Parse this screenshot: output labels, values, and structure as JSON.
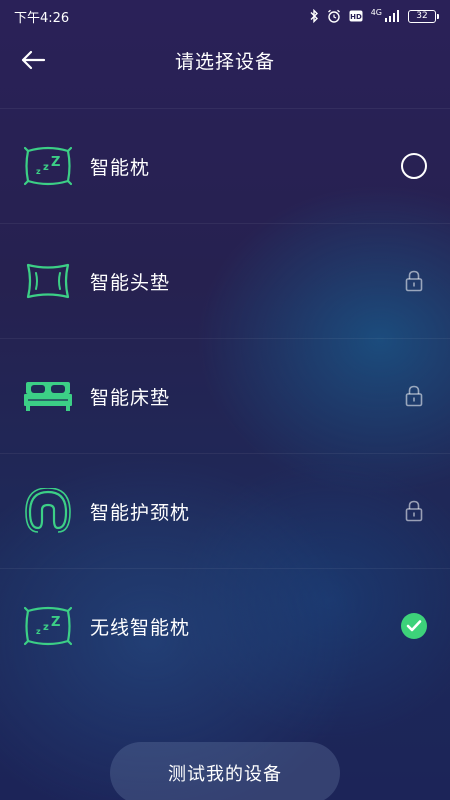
{
  "status_bar": {
    "time": "下午4:26",
    "network": "4G",
    "battery": "32"
  },
  "header": {
    "title": "请选择设备"
  },
  "devices": [
    {
      "label": "智能枕",
      "state": "unselected"
    },
    {
      "label": "智能头垫",
      "state": "locked"
    },
    {
      "label": "智能床垫",
      "state": "locked"
    },
    {
      "label": "智能护颈枕",
      "state": "locked"
    },
    {
      "label": "无线智能枕",
      "state": "selected"
    }
  ],
  "footer": {
    "test_button": "测试我的设备"
  },
  "colors": {
    "icon_green": "#3ccf86",
    "check_green": "#3dd27a"
  }
}
